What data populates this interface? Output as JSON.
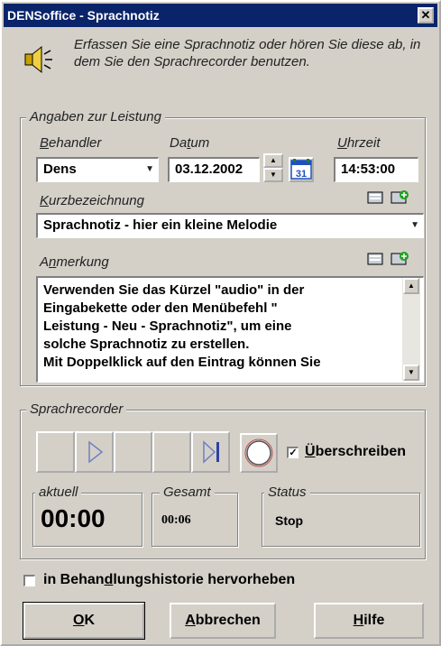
{
  "window": {
    "title": "DENSoffice - Sprachnotiz",
    "close_glyph": "✕"
  },
  "intro": {
    "icon": "speaker-icon",
    "text": "Erfassen Sie eine Sprachnotiz oder hören Sie diese ab, in dem Sie den Sprachrecorder benutzen."
  },
  "leistung": {
    "group_title": "Angaben zur Leistung",
    "behandler": {
      "label_pre": "",
      "label_u": "B",
      "label_post": "ehandler",
      "value": "Dens"
    },
    "datum": {
      "label_pre": "Da",
      "label_u": "t",
      "label_post": "um",
      "value": "03.12.2002",
      "calendar_day": "31"
    },
    "uhrzeit": {
      "label_pre": "",
      "label_u": "U",
      "label_post": "hrzeit",
      "value": "14:53:00"
    },
    "kurz": {
      "label_pre": "",
      "label_u": "K",
      "label_post": "urzbezeichnung",
      "value": "Sprachnotiz - hier ein kleine Melodie"
    },
    "anmerkung": {
      "label_pre": "A",
      "label_u": "n",
      "label_post": "merkung",
      "lines": [
        "Verwenden Sie das Kürzel \"audio\" in der",
        "Eingabekette oder den Menübefehl \"",
        "Leistung - Neu - Sprachnotiz\", um eine",
        "solche Sprachnotiz zu erstellen.",
        "Mit Doppelklick auf den Eintrag können Sie"
      ]
    }
  },
  "recorder": {
    "group_title": "Sprachrecorder",
    "overwrite_label_u": "Ü",
    "overwrite_label_post": "berschreiben",
    "overwrite_checked": true,
    "check_glyph": "✓",
    "aktuell_label": "aktuell",
    "aktuell_value": "00:00",
    "gesamt_label": "Gesamt",
    "gesamt_value": "00:06",
    "status_label": "Status",
    "status_value": "Stop"
  },
  "historie": {
    "label_pre": "in Behan",
    "label_u": "d",
    "label_post": "lungshistorie hervorheben",
    "checked": false
  },
  "buttons": {
    "ok_u": "O",
    "ok_post": "K",
    "abbrechen_u": "A",
    "abbrechen_post": "bbrechen",
    "hilfe_u": "H",
    "hilfe_post": "ilfe"
  }
}
